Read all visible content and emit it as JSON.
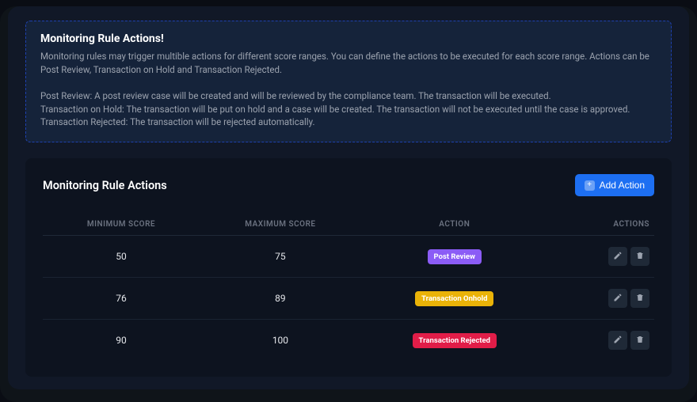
{
  "banner": {
    "title": "Monitoring Rule Actions!",
    "body": "Monitoring rules may trigger multible actions for different score ranges. You can define the actions to be executed for each score range. Actions can be Post Review, Transaction on Hold and Transaction Rejected.\n\nPost Review: A post review case will be created and will be reviewed by the compliance team. The transaction will be executed.\nTransaction on Hold: The transaction will be put on hold and a case will be created. The transaction will not be executed until the case is approved.\nTransaction Rejected: The transaction will be rejected automatically."
  },
  "card": {
    "title": "Monitoring Rule Actions",
    "add_label": "Add Action"
  },
  "table": {
    "headers": {
      "min": "MINIMUM SCORE",
      "max": "MAXIMUM SCORE",
      "action": "ACTION",
      "actions": "ACTIONS"
    },
    "rows": [
      {
        "min": "50",
        "max": "75",
        "badge": "Post Review",
        "badge_color": "#8b5cf6"
      },
      {
        "min": "76",
        "max": "89",
        "badge": "Transaction Onhold",
        "badge_color": "#eab308"
      },
      {
        "min": "90",
        "max": "100",
        "badge": "Transaction Rejected",
        "badge_color": "#e11d48"
      }
    ]
  },
  "colors": {
    "primary": "#1d6ff2"
  }
}
